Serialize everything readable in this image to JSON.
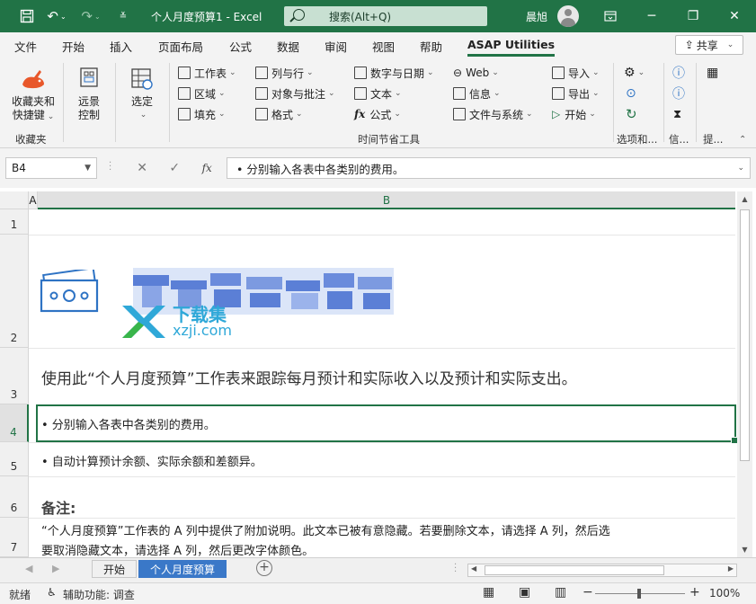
{
  "titlebar": {
    "doc_title": "个人月度预算1 - Excel",
    "search_placeholder": "搜索(Alt+Q)",
    "user_name": "晨旭",
    "min": "─",
    "restore": "❐",
    "close": "✕"
  },
  "tabs": [
    "文件",
    "开始",
    "插入",
    "页面布局",
    "公式",
    "数据",
    "审阅",
    "视图",
    "帮助",
    "ASAP Utilities"
  ],
  "share_label": "共享",
  "ribbon": {
    "favorites": {
      "label_line1": "收藏夹和",
      "label_line2": "快捷键",
      "group": "收藏夹"
    },
    "remote": {
      "label_line1": "远景",
      "label_line2": "控制"
    },
    "select": {
      "label": "选定"
    },
    "col1": [
      "工作表",
      "区域",
      "填充"
    ],
    "col2": [
      "列与行",
      "对象与批注",
      "格式"
    ],
    "col3": [
      "数字与日期",
      "文本",
      "公式"
    ],
    "col4": [
      "Web",
      "信息",
      "文件与系统"
    ],
    "col5": [
      "导入",
      "导出",
      "开始"
    ],
    "time_group": "时间节省工具",
    "group_options": "选项和...",
    "group_info": "信...",
    "group_tips": "提..."
  },
  "formula_bar": {
    "name_box": "B4",
    "formula": "• 分别输入各表中各类别的费用。"
  },
  "grid": {
    "col_a": "A",
    "col_b": "B",
    "rows": [
      "1",
      "2",
      "3",
      "4",
      "5",
      "6",
      "7"
    ],
    "watermark_line1": "下载集",
    "watermark_line2": "xzji.com",
    "row3": "使用此“个人月度预算”工作表来跟踪每月预计和实际收入以及预计和实际支出。",
    "row4": "• 分别输入各表中各类别的费用。",
    "row5": "• 自动计算预计余额、实际余额和差额异。",
    "row6": "备注:",
    "row6_line2": "“个人月度预算”工作表的 A 列中提供了附加说明。此文本已被有意隐藏。若要删除文本，请选择 A 列，然后选",
    "row7": "要取消隐藏文本，请选择 A 列，然后更改字体颜色。"
  },
  "sheets": [
    "开始",
    "个人月度预算"
  ],
  "status": {
    "ready": "就绪",
    "accessibility": "辅助功能: 调查",
    "zoom": "100%"
  },
  "colors": {
    "excel_green": "#217346",
    "active_sheet": "#3a78c8",
    "pixel_blue": "#5b7fd6"
  }
}
